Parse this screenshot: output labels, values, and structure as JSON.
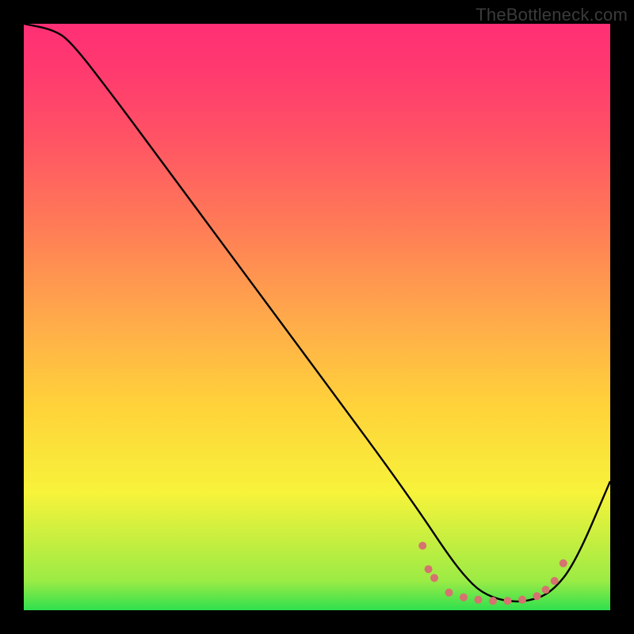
{
  "watermark": "TheBottleneck.com",
  "chart_data": {
    "type": "line",
    "title": "",
    "xlabel": "",
    "ylabel": "",
    "xlim": [
      0,
      100
    ],
    "ylim": [
      0,
      100
    ],
    "background_gradient": {
      "top": "#ff2f75",
      "bottom": "#2fe04e",
      "stops": [
        "#ff2f75",
        "#ff5464",
        "#ff7d56",
        "#ffa94b",
        "#ffd23a",
        "#f7f33a",
        "#9beb45",
        "#2fe04e"
      ]
    },
    "series": [
      {
        "name": "bottleneck-curve",
        "color": "#000000",
        "x": [
          0,
          5,
          8,
          15,
          25,
          35,
          45,
          55,
          62,
          68,
          72,
          75,
          78,
          82,
          86,
          90,
          94,
          100
        ],
        "y": [
          100,
          99,
          97,
          88,
          74.5,
          61,
          47.5,
          34,
          24.5,
          16,
          10,
          6,
          3,
          1.5,
          1.5,
          3,
          8,
          22
        ]
      }
    ],
    "markers": {
      "name": "dotted-band",
      "color": "#d6726f",
      "radius_px": 5,
      "points": [
        {
          "x": 68,
          "y": 11
        },
        {
          "x": 69,
          "y": 7
        },
        {
          "x": 70,
          "y": 5.5
        },
        {
          "x": 72.5,
          "y": 3
        },
        {
          "x": 75,
          "y": 2.2
        },
        {
          "x": 77.5,
          "y": 1.8
        },
        {
          "x": 80,
          "y": 1.6
        },
        {
          "x": 82.5,
          "y": 1.6
        },
        {
          "x": 85,
          "y": 1.8
        },
        {
          "x": 87.5,
          "y": 2.4
        },
        {
          "x": 89,
          "y": 3.5
        },
        {
          "x": 90.5,
          "y": 5
        },
        {
          "x": 92,
          "y": 8
        }
      ]
    }
  }
}
